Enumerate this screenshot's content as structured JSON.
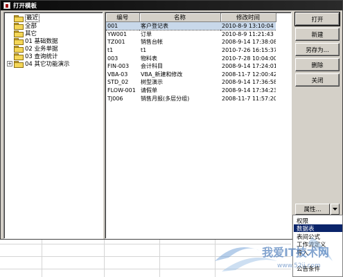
{
  "window": {
    "title": "打开模板"
  },
  "tree": {
    "items": [
      {
        "label": "最近",
        "selected": true
      },
      {
        "label": "全部"
      },
      {
        "label": "其它"
      },
      {
        "label": "01 基础数据"
      },
      {
        "label": "02 业务单据"
      },
      {
        "label": "03 查询统计"
      },
      {
        "label": "04 其它功能演示",
        "expander": "+"
      }
    ]
  },
  "list": {
    "columns": [
      "编号",
      "名称",
      "修改时间"
    ],
    "rows": [
      [
        "001",
        "客户登记表",
        "2010-8-9 13:10:04"
      ],
      [
        "YW001",
        "订单",
        "2010-8-9 11:21:43"
      ],
      [
        "TZ001",
        "销售台帐",
        "2008-9-14 17:38:08"
      ],
      [
        "t1",
        "t1",
        "2010-7-26 16:15:37"
      ],
      [
        "003",
        "物料表",
        "2010-7-28 10:04:00"
      ],
      [
        "FIN-003",
        "会计科目",
        "2008-9-14 17:24:01"
      ],
      [
        "VBA-03",
        "VBA_新建和修改",
        "2008-11-7 12:00:42"
      ],
      [
        "STD_02",
        "树型演示",
        "2008-9-14 17:36:58"
      ],
      [
        "FLOW-001",
        "请假单",
        "2008-9-14 17:34:23"
      ],
      [
        "TJ006",
        "销售月报(多层分组)",
        "2008-11-7 11:57:20"
      ]
    ]
  },
  "buttons": {
    "open": "打开",
    "new": "新建",
    "save_as": "另存为...",
    "delete": "删除",
    "close": "关闭",
    "properties": "属性...",
    "dropdown_icon": "chevron-down-icon"
  },
  "menu": {
    "items": [
      "权限",
      "数据表",
      "表间公式",
      "工作流定义",
      "导入",
      "公告条件"
    ],
    "active_index": 1
  },
  "watermark": {
    "text": "我爱IT技术网",
    "url": "www.52ij.com"
  },
  "colors": {
    "dialog_bg": "#d4d0c8",
    "selection_row": "#c8d8ea",
    "menu_active": "#0a246a",
    "folder": "#f4d657"
  }
}
